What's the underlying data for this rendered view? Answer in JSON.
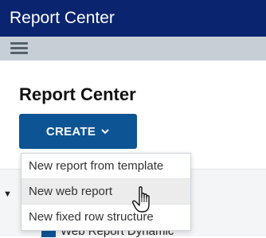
{
  "app": {
    "title": "Report Center"
  },
  "toolbar": {
    "menu_icon": "hamburger-menu-icon"
  },
  "page": {
    "title": "Report Center"
  },
  "create_button": {
    "label": "CREATE",
    "icon": "chevron-down-icon"
  },
  "dropdown": {
    "items": [
      {
        "label": "New report from template"
      },
      {
        "label": "New web report"
      },
      {
        "label": "New fixed row structure"
      }
    ],
    "hovered_index": 1
  },
  "tree": {
    "toggle_icon": "caret-down-icon",
    "node_label": "Web Report Dynamic"
  },
  "colors": {
    "header_bg": "#0b2470",
    "toolbar_bg": "#c7ced6",
    "button_bg": "#0c5494"
  }
}
